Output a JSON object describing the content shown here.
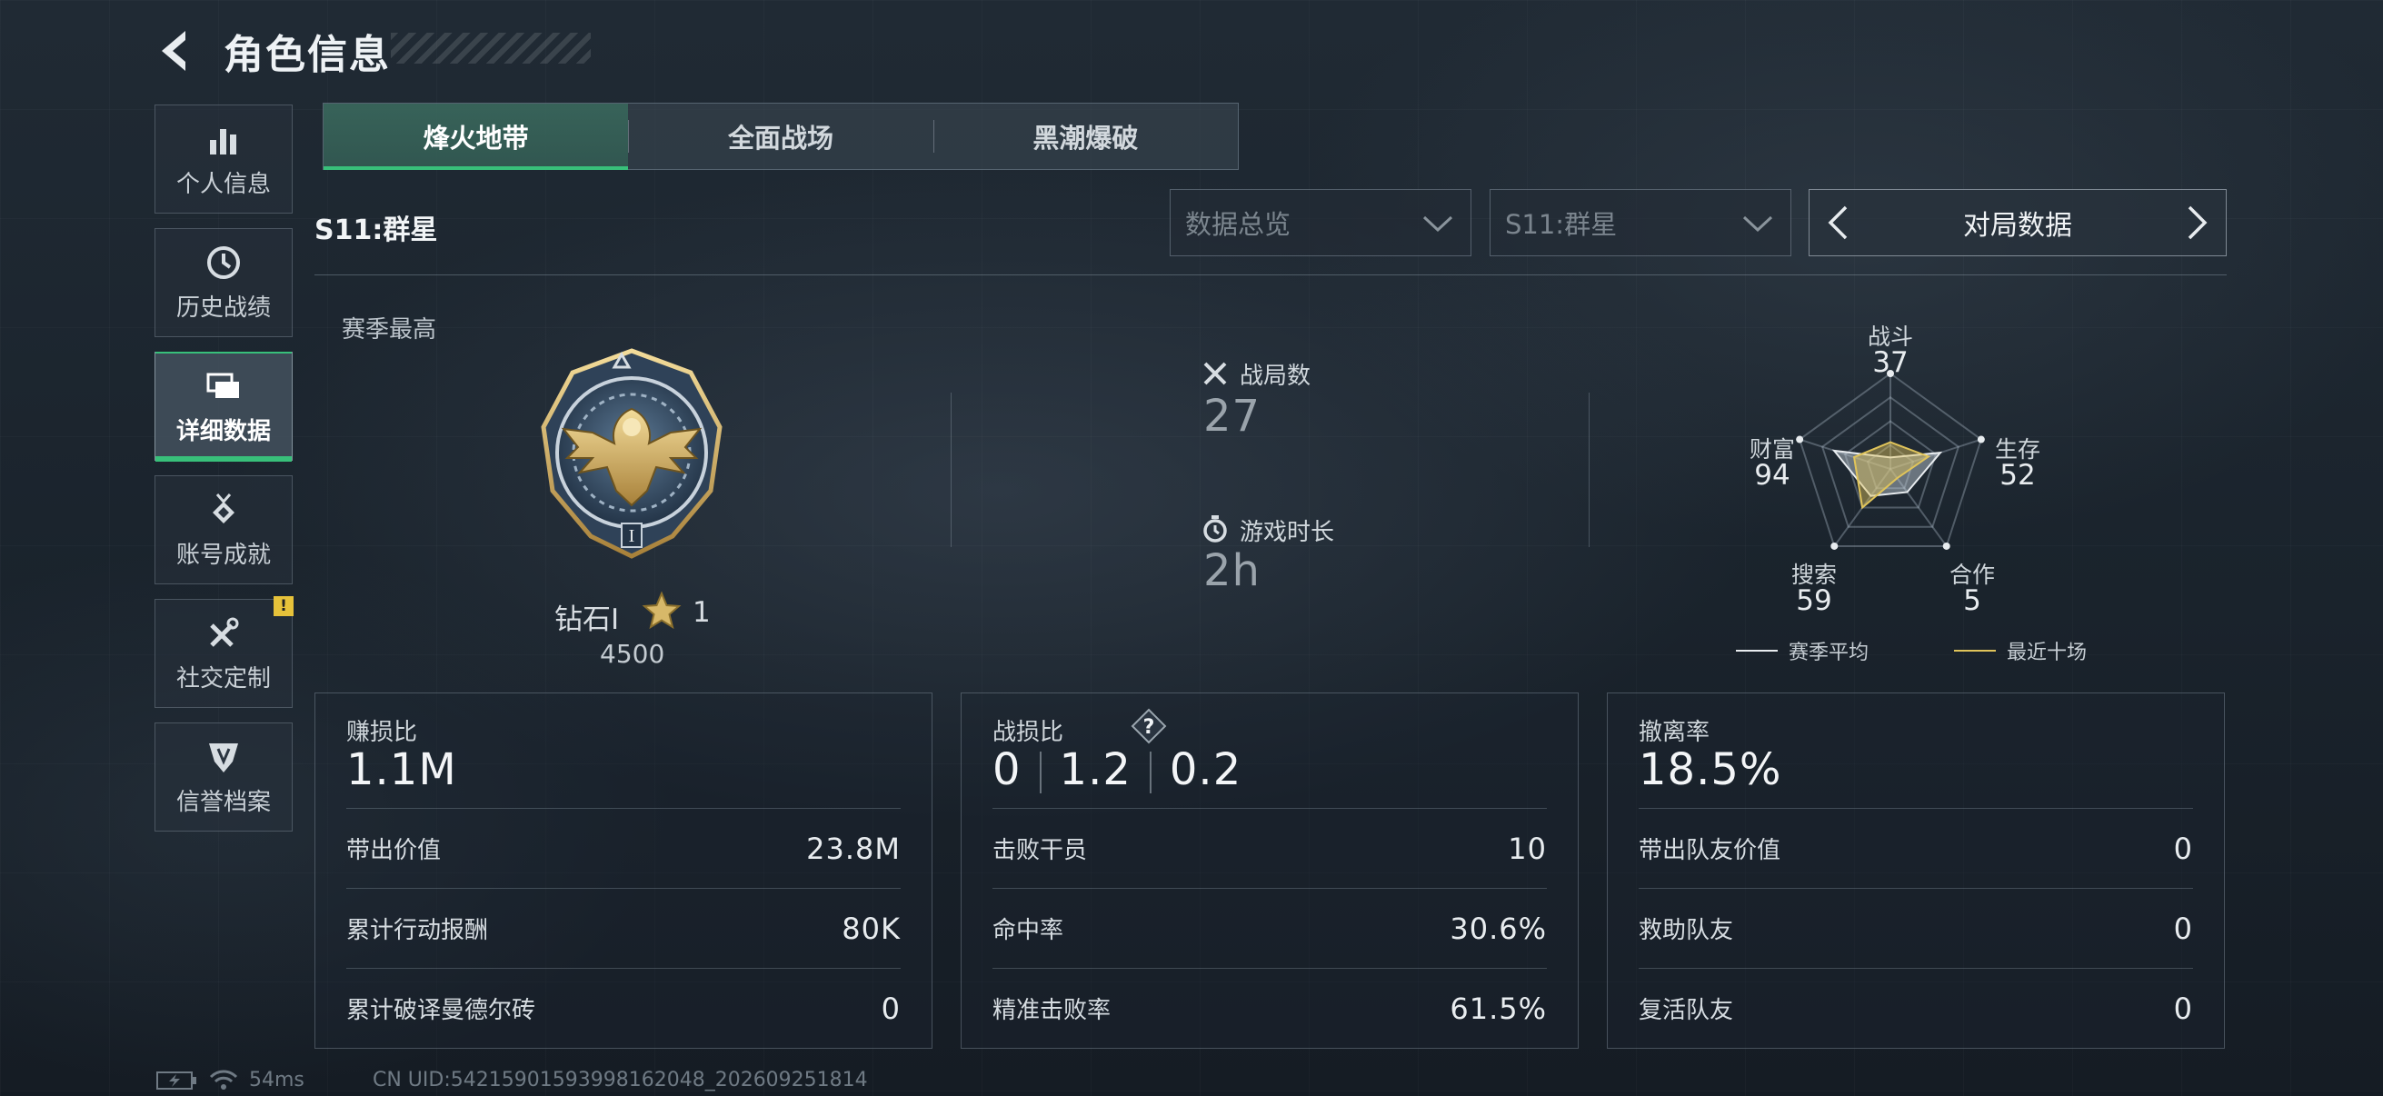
{
  "header": {
    "title": "角色信息"
  },
  "sidebar": {
    "items": [
      {
        "label": "个人信息",
        "icon": "bar-chart-icon",
        "active": false
      },
      {
        "label": "历史战绩",
        "icon": "clock-icon",
        "active": false
      },
      {
        "label": "详细数据",
        "icon": "cards-icon",
        "active": true
      },
      {
        "label": "账号成就",
        "icon": "medal-icon",
        "active": false
      },
      {
        "label": "社交定制",
        "icon": "tools-icon",
        "active": false,
        "badge": "!"
      },
      {
        "label": "信誉档案",
        "icon": "shield-icon",
        "active": false
      }
    ]
  },
  "tabs": [
    {
      "label": "烽火地带",
      "active": true
    },
    {
      "label": "全面战场",
      "active": false
    },
    {
      "label": "黑潮爆破",
      "active": false
    }
  ],
  "season_label": "S11:群星",
  "filters": {
    "view": "数据总览",
    "season": "S11:群星",
    "mode": "对局数据"
  },
  "rank": {
    "section_label": "赛季最高",
    "name": "钻石I",
    "stars": "1",
    "score": "4500"
  },
  "summary": {
    "matches_label": "战局数",
    "matches_value": "27",
    "playtime_label": "游戏时长",
    "playtime_value": "2h"
  },
  "radar": {
    "axes": [
      {
        "label": "战斗",
        "value": "37"
      },
      {
        "label": "生存",
        "value": "52"
      },
      {
        "label": "合作",
        "value": "5"
      },
      {
        "label": "搜索",
        "value": "59"
      },
      {
        "label": "财富",
        "value": "94"
      }
    ],
    "season_avg": [
      0.12,
      0.55,
      0.3,
      0.35,
      0.62
    ],
    "recent_ten": [
      0.28,
      0.42,
      0.12,
      0.5,
      0.4
    ],
    "legend": {
      "season_avg": "赛季平均",
      "recent_ten": "最近十场"
    },
    "colors": {
      "season_avg": "#e9edf0",
      "recent_ten": "#e0c45a"
    }
  },
  "cards": {
    "profit": {
      "head_label": "赚损比",
      "head_value": "1.1M",
      "rows": [
        {
          "k": "带出价值",
          "v": "23.8M"
        },
        {
          "k": "累计行动报酬",
          "v": "80K"
        },
        {
          "k": "累计破译曼德尔砖",
          "v": "0"
        }
      ]
    },
    "combat": {
      "head_label": "战损比",
      "help": "?",
      "kd": [
        "0",
        "1.2",
        "0.2"
      ],
      "rows": [
        {
          "k": "击败干员",
          "v": "10"
        },
        {
          "k": "命中率",
          "v": "30.6%"
        },
        {
          "k": "精准击败率",
          "v": "61.5%"
        }
      ]
    },
    "extract": {
      "head_label": "撤离率",
      "head_value": "18.5%",
      "rows": [
        {
          "k": "带出队友价值",
          "v": "0"
        },
        {
          "k": "救助队友",
          "v": "0"
        },
        {
          "k": "复活队友",
          "v": "0"
        }
      ]
    }
  },
  "status": {
    "ping": "54ms",
    "uid": "CN UID:5421590159399816​2048_202609251814"
  },
  "colors": {
    "accent": "#38c07a",
    "badge": "#e6c23a"
  }
}
